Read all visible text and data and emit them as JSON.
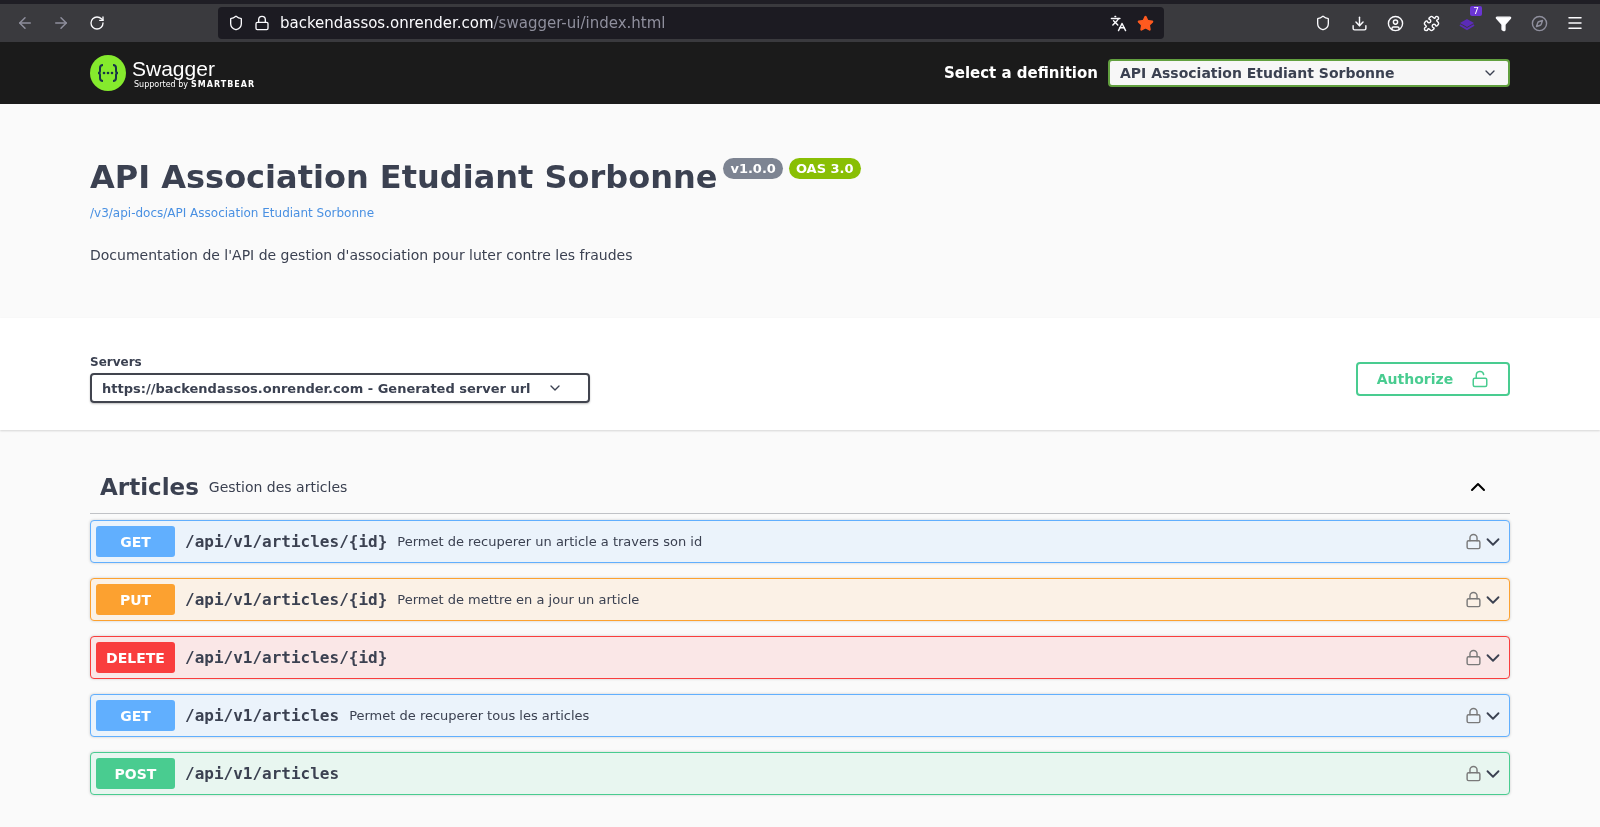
{
  "browser": {
    "url_host": "backendassos.onrender.com",
    "url_path": "/swagger-ui/index.html",
    "extension_badge": "7"
  },
  "topbar": {
    "logo_text": "Swagger",
    "logo_sub": "Supported by",
    "logo_brand": "SMARTBEAR",
    "definition_label": "Select a definition",
    "definition_value": "API Association Etudiant Sorbonne"
  },
  "info": {
    "title": "API Association Etudiant Sorbonne",
    "version": "v1.0.0",
    "oas": "OAS 3.0",
    "link": "/v3/api-docs/API Association Etudiant Sorbonne",
    "description": "Documentation de l'API de gestion d'association pour luter contre les fraudes"
  },
  "servers": {
    "label": "Servers",
    "value": "https://backendassos.onrender.com - Generated server url",
    "authorize": "Authorize"
  },
  "tag": {
    "name": "Articles",
    "description": "Gestion des articles",
    "expanded": true,
    "operations": [
      {
        "method": "GET",
        "path": "/api/v1/articles/{id}",
        "summary": "Permet de recuperer un article a travers son id"
      },
      {
        "method": "PUT",
        "path": "/api/v1/articles/{id}",
        "summary": "Permet de mettre en a jour un article"
      },
      {
        "method": "DELETE",
        "path": "/api/v1/articles/{id}"
      },
      {
        "method": "GET",
        "path": "/api/v1/articles",
        "summary": "Permet de recuperer tous les articles"
      },
      {
        "method": "POST",
        "path": "/api/v1/articles"
      }
    ]
  }
}
